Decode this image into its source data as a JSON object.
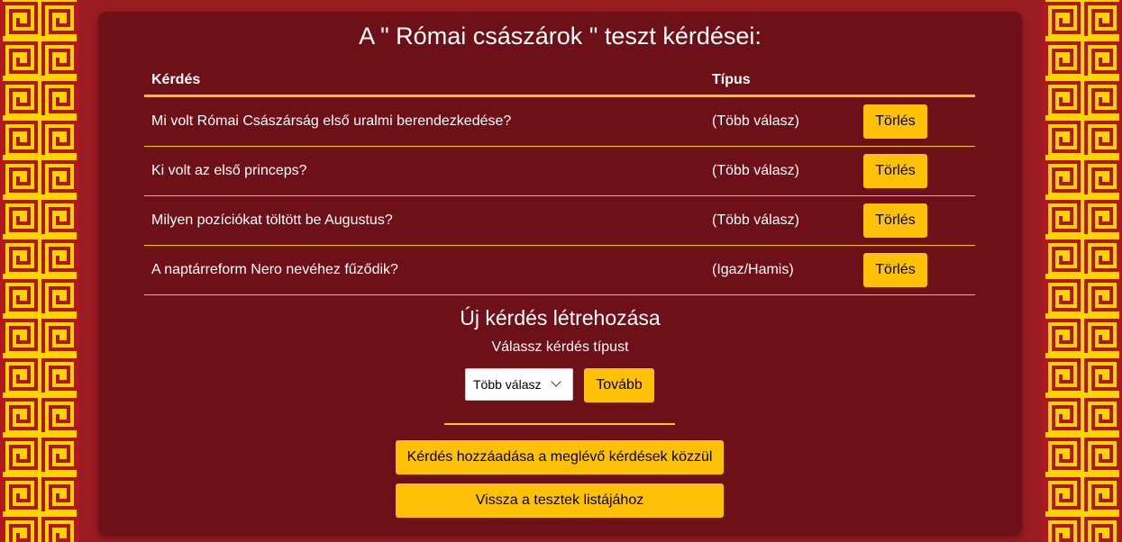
{
  "title": "A \" Római császárok \" teszt kérdései:",
  "table": {
    "headers": [
      "Kérdés",
      "Típus"
    ],
    "rows": [
      {
        "question": "Mi volt Római Császárság első uralmi berendezkedése?",
        "type": "(Több válasz)",
        "action": "Törlés"
      },
      {
        "question": "Ki volt az első princeps?",
        "type": "(Több válasz)",
        "action": "Törlés"
      },
      {
        "question": "Milyen pozíciókat töltött be Augustus?",
        "type": "(Több válasz)",
        "action": "Törlés"
      },
      {
        "question": "A naptárreform Nero nevéhez fűződik?",
        "type": "(Igaz/Hamis)",
        "action": "Törlés"
      }
    ]
  },
  "new_question": {
    "heading": "Új kérdés létrehozása",
    "type_label": "Válassz kérdés típust",
    "selected_type": "Több válasz",
    "next_label": "Tovább"
  },
  "actions": {
    "add_existing": "Kérdés hozzáadása a meglévő kérdések közzül",
    "back": "Vissza a tesztek listájához"
  },
  "colors": {
    "background": "#9b1c22",
    "panel": "#6e1017",
    "accent": "#ffc107",
    "border_pattern": "#ffd400"
  }
}
